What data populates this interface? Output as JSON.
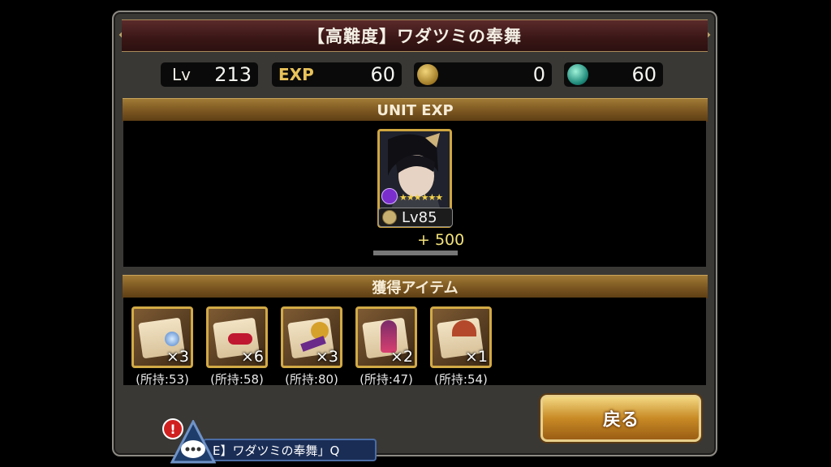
{
  "title": "【高難度】ワダツミの奉舞",
  "stats": {
    "lv_label": "Lv",
    "lv_value": "213",
    "exp_label": "EXP",
    "exp_value": "60",
    "gold_value": "0",
    "orb_value": "60"
  },
  "unit_section": {
    "header": "UNIT EXP",
    "unit_level": "Lv85",
    "exp_gain": "+ 500"
  },
  "items_section": {
    "header": "獲得アイテム",
    "items": [
      {
        "count": "×3",
        "owned": "(所持:53)"
      },
      {
        "count": "×6",
        "owned": "(所持:58)"
      },
      {
        "count": "×3",
        "owned": "(所持:80)"
      },
      {
        "count": "×2",
        "owned": "(所持:47)"
      },
      {
        "count": "×1",
        "owned": "(所持:54)"
      }
    ]
  },
  "back_button": "戻る",
  "chat": {
    "text": "E】ワダツミの奉舞」Q",
    "alert": "!"
  },
  "colors": {
    "gold_border": "#d0a640",
    "title_bg": "#4a1e1e",
    "panel_bg": "#3a3835"
  }
}
